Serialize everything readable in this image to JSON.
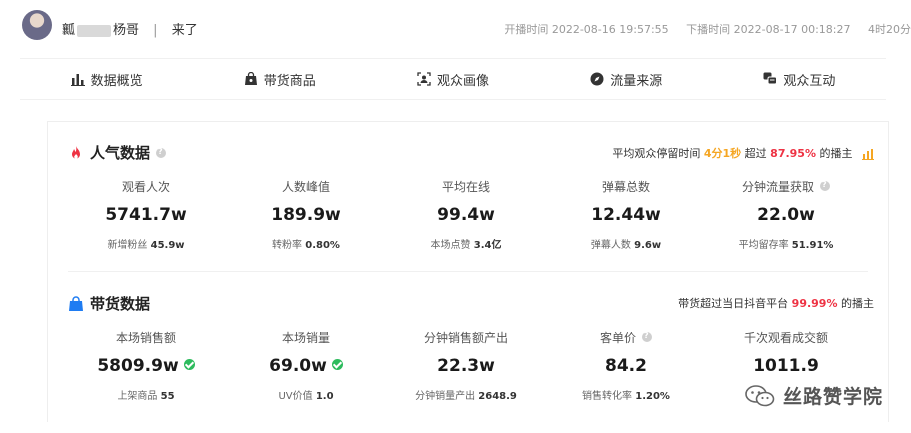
{
  "header": {
    "streamer_prefix": "瓤",
    "streamer_suffix": "杨哥",
    "separator": "|",
    "status": "来了",
    "start_time": "开播时间 2022-08-16 19:57:55",
    "end_time": "下播时间 2022-08-17 00:18:27",
    "duration": "4时20分"
  },
  "nav": {
    "items": [
      {
        "label": "数据概览",
        "icon": "bar-chart-icon"
      },
      {
        "label": "带货商品",
        "icon": "shopping-bag-icon"
      },
      {
        "label": "观众画像",
        "icon": "user-scan-icon"
      },
      {
        "label": "流量来源",
        "icon": "compass-icon"
      },
      {
        "label": "观众互动",
        "icon": "chat-icon"
      }
    ]
  },
  "popularity": {
    "title": "人气数据",
    "note_prefix": "平均观众停留时间",
    "note_value": "4分1秒",
    "note_mid": "超过",
    "note_percent": "87.95%",
    "note_suffix": "的播主",
    "metrics": [
      {
        "label": "观看人次",
        "value": "5741.7w",
        "sub_label": "新增粉丝",
        "sub_value": "45.9w"
      },
      {
        "label": "人数峰值",
        "value": "189.9w",
        "sub_label": "转粉率",
        "sub_value": "0.80%"
      },
      {
        "label": "平均在线",
        "value": "99.4w",
        "sub_label": "本场点赞",
        "sub_value": "3.4亿"
      },
      {
        "label": "弹幕总数",
        "value": "12.44w",
        "sub_label": "弹幕人数",
        "sub_value": "9.6w"
      },
      {
        "label": "分钟流量获取",
        "value": "22.0w",
        "sub_label": "平均留存率",
        "sub_value": "51.91%"
      }
    ]
  },
  "sales": {
    "title": "带货数据",
    "note_prefix": "带货超过当日抖音平台",
    "note_percent": "99.99%",
    "note_suffix": "的播主",
    "metrics": [
      {
        "label": "本场销售额",
        "value": "5809.9w",
        "sub_label": "上架商品",
        "sub_value": "55"
      },
      {
        "label": "本场销量",
        "value": "69.0w",
        "sub_label": "UV价值",
        "sub_value": "1.0"
      },
      {
        "label": "分钟销售额产出",
        "value": "22.3w",
        "sub_label": "分钟销量产出",
        "sub_value": "2648.9"
      },
      {
        "label": "客单价",
        "value": "84.2",
        "sub_label": "销售转化率",
        "sub_value": "1.20%"
      },
      {
        "label": "千次观看成交额",
        "value": "1011.9",
        "sub_label": "",
        "sub_value": ""
      }
    ]
  },
  "watermark": {
    "text": "丝路赞学院"
  },
  "colors": {
    "fire": "#ee3344",
    "bag": "#1f7cf2",
    "highlight": "#f5a623",
    "check": "#2dbb5d"
  }
}
